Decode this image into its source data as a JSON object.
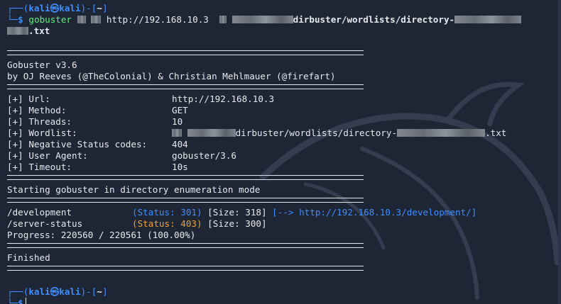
{
  "prompt": {
    "corner_top": "┌──(",
    "user": "kali㉿kali",
    "close_open": ")-[",
    "dir": "~",
    "close": "]",
    "corner_bottom": "└─",
    "symbol": "$"
  },
  "command": {
    "program": "gobuster",
    "url": "http://192.168.10.3",
    "wordlist_mid": "dirbuster/wordlists/directory-",
    "wordlist_end": ".txt"
  },
  "banner": {
    "version": "Gobuster v3.6",
    "authors": "by OJ Reeves (@TheColonial) & Christian Mehlmauer (@firefart)"
  },
  "config": [
    {
      "key": "[+] Url:",
      "value": "http://192.168.10.3"
    },
    {
      "key": "[+] Method:",
      "value": "GET"
    },
    {
      "key": "[+] Threads:",
      "value": "10"
    },
    {
      "key": "[+] Wordlist:",
      "value_mid": "dirbuster/wordlists/directory-",
      "value_end": ".txt"
    },
    {
      "key": "[+] Negative Status codes:",
      "value": "404"
    },
    {
      "key": "[+] User Agent:",
      "value": "gobuster/3.6"
    },
    {
      "key": "[+] Timeout:",
      "value": "10s"
    }
  ],
  "start_message": "Starting gobuster in directory enumeration mode",
  "results": [
    {
      "path": "/development",
      "status": "(Status: 301)",
      "size": "[Size: 318]",
      "redirect": "[--> http://192.168.10.3/development/]"
    },
    {
      "path": "/server-status",
      "status": "(Status: 403)",
      "size": "[Size: 300]"
    }
  ],
  "progress": "Progress: 220560 / 220561 (100.00%)",
  "finished": "Finished",
  "colors": {
    "background": "#1e2636",
    "prompt_blue": "#3f8fff",
    "status_301": "#3f8fff",
    "status_403": "#f0a030",
    "command_green": "#5ff07a"
  }
}
